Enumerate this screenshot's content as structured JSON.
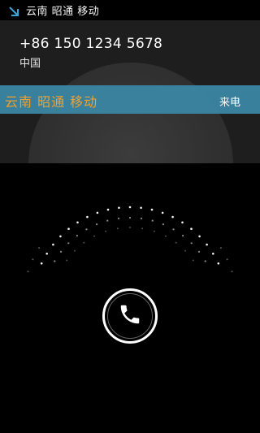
{
  "status_bar": {
    "icon": "call-incoming-arrow-icon",
    "text": "云南 昭通 移动"
  },
  "caller": {
    "number": "+86 150 1234 5678",
    "country": "中国",
    "location": "云南 昭通 移动",
    "call_state": "来电"
  },
  "colors": {
    "location_bar": "#3a88a5",
    "location_text": "#f0a030",
    "status_icon": "#3ba3d8"
  },
  "answer": {
    "icon": "phone-icon"
  }
}
